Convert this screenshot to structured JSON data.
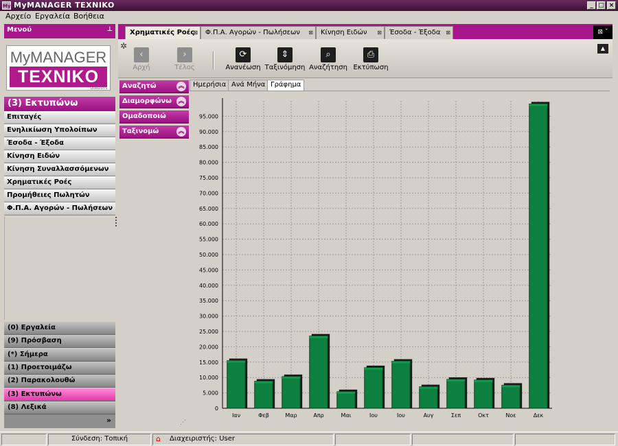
{
  "window": {
    "app_icon": "My",
    "title": "MyMANAGER TEXNIKO",
    "controls": {
      "minimize": "_",
      "maximize": "□",
      "close": "×"
    }
  },
  "menu": {
    "items": [
      "Αρχείο",
      "Εργαλεία",
      "Βοήθεια"
    ]
  },
  "left_panel": {
    "header": "Μενού",
    "pin_icon": "pin-icon",
    "logo": {
      "line1": "MyMANAGER",
      "line2": "TEXNIKO",
      "tag": "QUALISYS"
    },
    "section_title": "(3) Εκτυπώνω",
    "items": [
      "Επιταγές",
      "Ενηλικίωση Υπολοίπων",
      "Έσοδα - Έξοδα",
      "Κίνηση Ειδών",
      "Κίνηση Συναλλασσόμενων",
      "Χρηματικές Ροές",
      "Προμήθειες Πωλητών",
      "Φ.Π.Α. Αγορών - Πωλήσεων"
    ],
    "bottom_items": [
      {
        "label": "(0) Εργαλεία",
        "active": false
      },
      {
        "label": "(9) Πρόσβαση",
        "active": false
      },
      {
        "label": "(*) Σήμερα",
        "active": false
      },
      {
        "label": "(1) Προετοιμάζω",
        "active": false
      },
      {
        "label": "(2) Παρακολουθώ",
        "active": false
      },
      {
        "label": "(3) Εκτυπώνω",
        "active": true
      },
      {
        "label": "(8) Λεξικά",
        "active": false
      }
    ],
    "more_glyph": "»"
  },
  "tabs": [
    {
      "label": "Χρηματικές Ροές",
      "active": true
    },
    {
      "label": "Φ.Π.Α. Αγορών - Πωλήσεων",
      "active": false
    },
    {
      "label": "Κίνηση Ειδών",
      "active": false
    },
    {
      "label": "Έσοδα - Έξοδα",
      "active": false
    }
  ],
  "tab_close_glyph": "⊠ ˇ",
  "toolbar": {
    "first": {
      "label": "Αρχή",
      "icon": "chevron-left-icon",
      "glyph": "‹"
    },
    "last": {
      "label": "Τέλος",
      "icon": "chevron-right-icon",
      "glyph": "›"
    },
    "refresh": {
      "label": "Ανανέωση",
      "icon": "refresh-icon",
      "glyph": "⟳"
    },
    "sort": {
      "label": "Ταξινόμηση",
      "icon": "sort-icon",
      "glyph": "⇕"
    },
    "search": {
      "label": "Αναζήτηση",
      "icon": "search-icon",
      "glyph": "⌕"
    },
    "print": {
      "label": "Εκτύπωση",
      "icon": "printer-icon",
      "glyph": "⎙"
    }
  },
  "filter_panel": [
    {
      "label": "Αναζητώ",
      "chevron": "︽"
    },
    {
      "label": "Διαμορφώνω",
      "chevron": "︽"
    },
    {
      "label": "Ομαδοποιώ",
      "chevron": ""
    },
    {
      "label": "Ταξινομώ",
      "chevron": "︽"
    }
  ],
  "subtabs": [
    {
      "label": "Ημερήσια",
      "active": false
    },
    {
      "label": "Ανά Μήνα",
      "active": false
    },
    {
      "label": "Γράφημα",
      "active": true
    }
  ],
  "colors": {
    "accent": "#a8158a",
    "bar": "#0d8040",
    "bar_top": "#0f9a4d"
  },
  "chart_data": {
    "type": "bar",
    "categories": [
      "Ιαν",
      "Φεβ",
      "Μαρ",
      "Απρ",
      "Μαι",
      "Ιου",
      "Ιου",
      "Αυγ",
      "Σεπ",
      "Οκτ",
      "Νοε",
      "Δεκ"
    ],
    "values": [
      15500,
      8800,
      10300,
      23500,
      5400,
      13200,
      15300,
      7000,
      9400,
      9200,
      7500,
      99000
    ],
    "ylim": [
      0,
      100000
    ],
    "yticks": [
      "0",
      "5.000",
      "10.000",
      "15.000",
      "20.000",
      "25.000",
      "30.000",
      "35.000",
      "40.000",
      "45.000",
      "50.000",
      "55.000",
      "60.000",
      "65.000",
      "70.000",
      "75.000",
      "80.000",
      "85.000",
      "90.000",
      "95.000"
    ],
    "title": "",
    "xlabel": "",
    "ylabel": "",
    "grid": true
  },
  "status": {
    "connection": "Σύνδεση: Τοπική",
    "user": "Διαχειριστής: User"
  }
}
